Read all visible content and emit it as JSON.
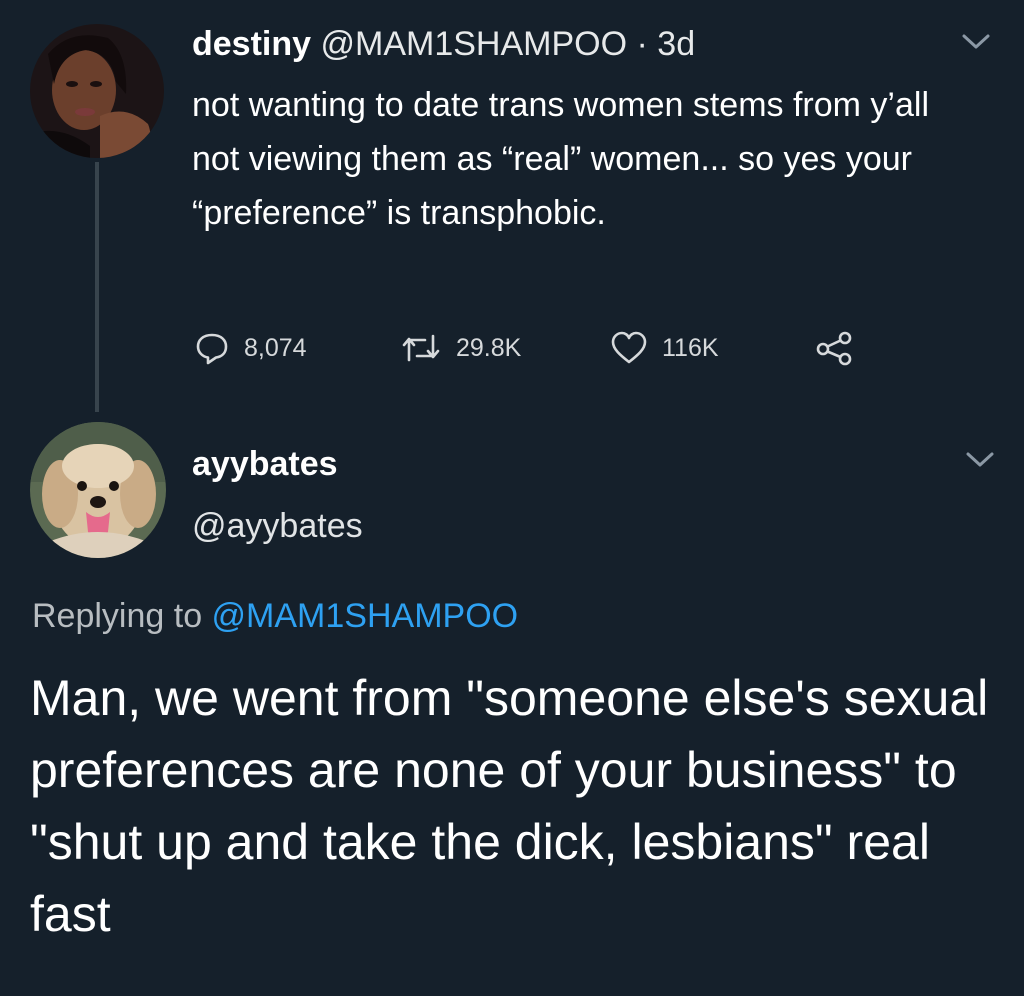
{
  "tweet1": {
    "display_name": "destiny",
    "handle": "@MAM1SHAMPOO",
    "separator": "·",
    "time": "3d",
    "text": "not wanting to date trans women stems from y’all not viewing them as “real” women... so yes your “preference” is transphobic.",
    "replies": "8,074",
    "retweets": "29.8K",
    "likes": "116K",
    "icons": [
      "chevron-down-icon",
      "reply-icon",
      "retweet-icon",
      "like-icon",
      "share-icon"
    ]
  },
  "tweet2": {
    "display_name": "ayybates",
    "handle": "@ayybates",
    "replying_prefix": "Replying to ",
    "replying_to": "@MAM1SHAMPOO",
    "text": "Man, we went from \"someone else's sexual preferences are none of your business\" to \"shut up and take the dick, lesbians\" real fast",
    "icons": [
      "chevron-down-icon"
    ]
  },
  "colors": {
    "background": "#15202b",
    "text": "#ffffff",
    "secondary_text": "#b8bdc1",
    "link": "#2ea1f2",
    "thread_line": "#38444d"
  }
}
